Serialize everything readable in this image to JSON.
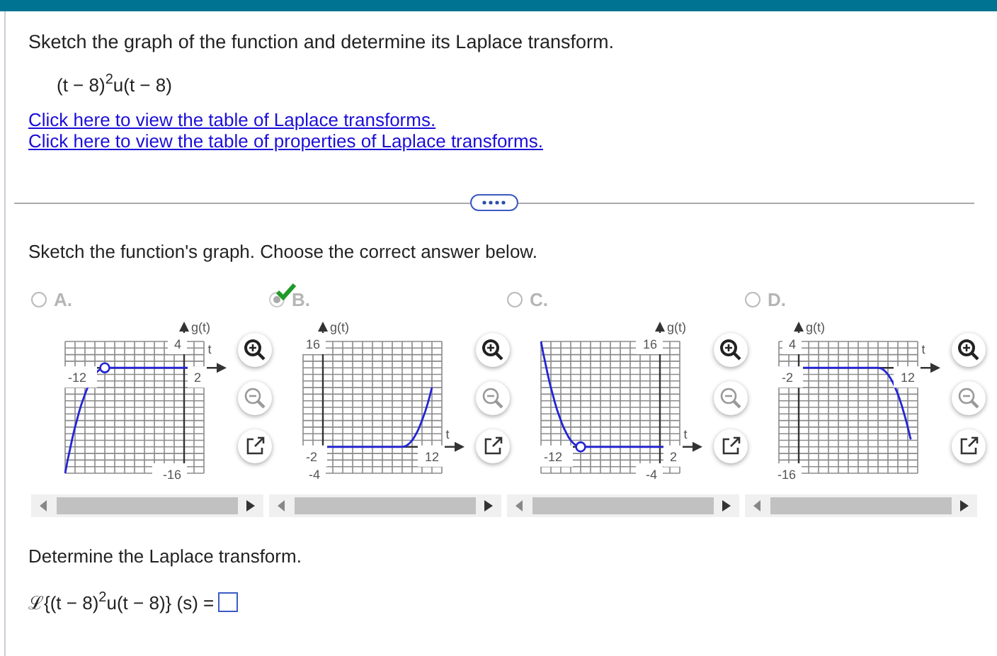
{
  "question": {
    "prompt": "Sketch the graph of the function and determine its Laplace transform.",
    "formula": "(t − 8)$^{2}$u(t − 8)",
    "links": [
      "Click here to view the table of Laplace transforms.",
      "Click here to view the table of properties of Laplace transforms."
    ]
  },
  "part1": {
    "instruction": "Sketch the function's graph. Choose the correct answer below.",
    "options": [
      {
        "letter": "A.",
        "selected": false,
        "disabled": true,
        "marked_correct": false,
        "graph": {
          "kind": "rise_left",
          "y_label": "g(t)",
          "x_label": "t",
          "x_min": "-12",
          "x_max": "2",
          "y_max": "4",
          "y_min": "-16"
        }
      },
      {
        "letter": "B.",
        "selected": true,
        "disabled": true,
        "marked_correct": true,
        "graph": {
          "kind": "rise_right",
          "y_label": "g(t)",
          "x_label": "t",
          "x_min": "-2",
          "x_max": "12",
          "y_max": "16",
          "y_min": "-4"
        }
      },
      {
        "letter": "C.",
        "selected": false,
        "disabled": true,
        "marked_correct": false,
        "graph": {
          "kind": "fall_left",
          "y_label": "g(t)",
          "x_label": "t",
          "x_min": "-12",
          "x_max": "2",
          "y_max": "16",
          "y_min": "-4"
        }
      },
      {
        "letter": "D.",
        "selected": false,
        "disabled": true,
        "marked_correct": false,
        "graph": {
          "kind": "fall_right",
          "y_label": "g(t)",
          "x_label": "t",
          "x_min": "-2",
          "x_max": "12",
          "y_max": "4",
          "y_min": "-16"
        }
      }
    ]
  },
  "part2": {
    "instruction": "Determine the Laplace transform.",
    "expression": "ℒ{(t − 8)$^{2}$u(t − 8)} (s) ="
  }
}
